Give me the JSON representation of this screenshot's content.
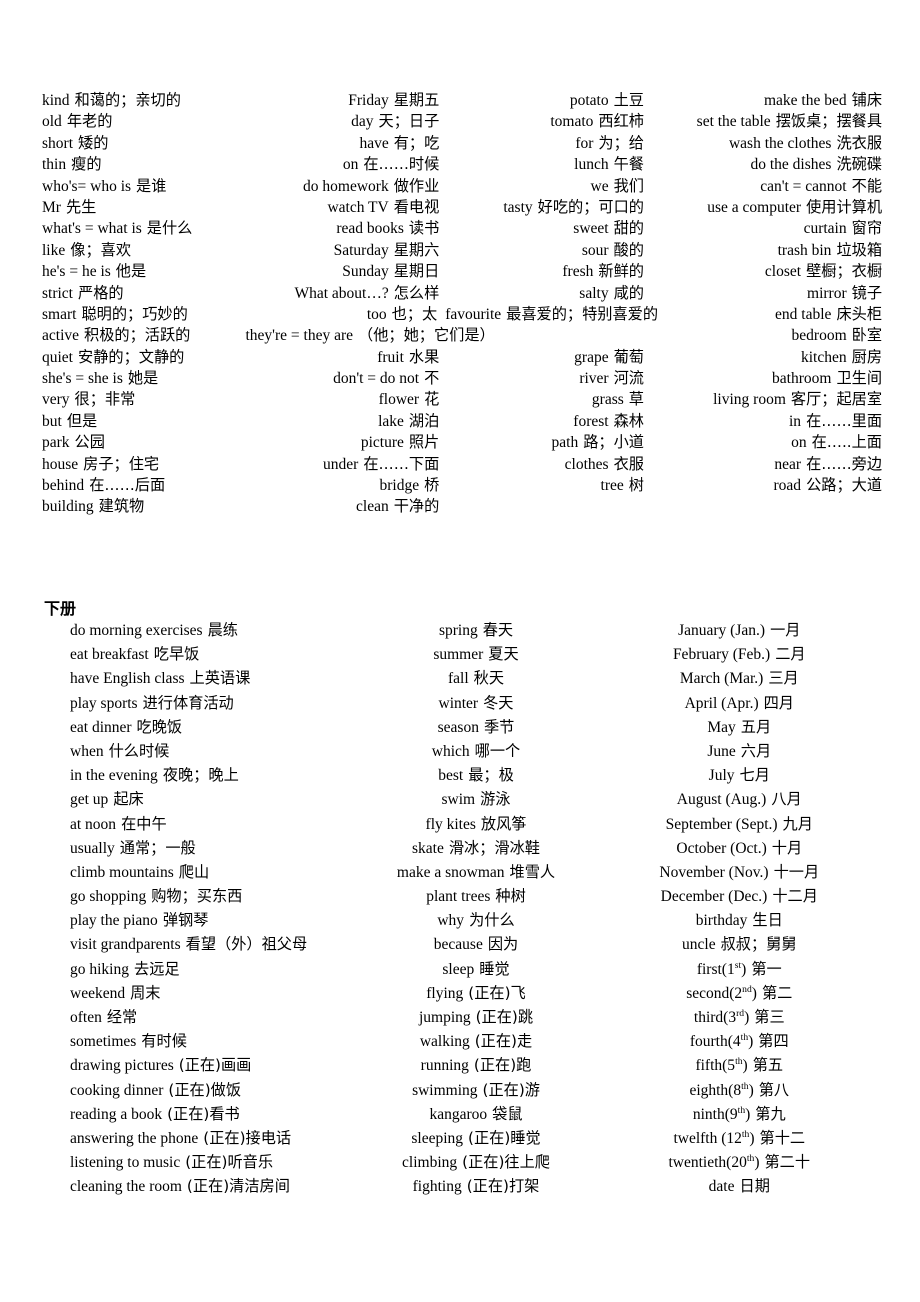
{
  "document": {
    "section1": {
      "rows": [
        [
          {
            "en": "kind",
            "zh": "和蔼的；亲切的"
          },
          {
            "en": "Friday",
            "zh": "星期五"
          },
          {
            "en": "potato",
            "zh": "土豆"
          },
          {
            "en": "make the bed",
            "zh": "铺床"
          }
        ],
        [
          {
            "en": "old",
            "zh": "年老的"
          },
          {
            "en": "day",
            "zh": "天；日子"
          },
          {
            "en": "tomato",
            "zh": "西红柿"
          },
          {
            "en": "set the table",
            "zh": "摆饭桌；摆餐具"
          }
        ],
        [
          {
            "en": "short",
            "zh": "矮的"
          },
          {
            "en": "have",
            "zh": "有；吃"
          },
          {
            "en": "for",
            "zh": "为；给"
          },
          {
            "en": "wash the clothes",
            "zh": "洗衣服"
          }
        ],
        [
          {
            "en": "thin",
            "zh": "瘦的"
          },
          {
            "en": "on",
            "zh": "在……时候"
          },
          {
            "en": "lunch",
            "zh": "午餐"
          },
          {
            "en": "do the dishes",
            "zh": "洗碗碟"
          }
        ],
        [
          {
            "en": "who's= who is",
            "zh": "是谁"
          },
          {
            "en": "do homework",
            "zh": "做作业"
          },
          {
            "en": "we",
            "zh": "我们"
          },
          {
            "en": "can't = cannot",
            "zh": "不能"
          }
        ],
        [
          {
            "en": "Mr",
            "zh": "先生"
          },
          {
            "en": "watch TV",
            "zh": "看电视"
          },
          {
            "en": "tasty",
            "zh": "好吃的；可口的"
          },
          {
            "en": "use a computer",
            "zh": "使用计算机"
          }
        ],
        [
          {
            "en": "what's = what is",
            "zh": "是什么"
          },
          {
            "en": "read books",
            "zh": "读书"
          },
          {
            "en": "sweet",
            "zh": "甜的"
          },
          {
            "en": "curtain",
            "zh": "窗帘"
          }
        ],
        [
          {
            "en": "like",
            "zh": "像；喜欢"
          },
          {
            "en": "Saturday",
            "zh": "星期六"
          },
          {
            "en": "sour",
            "zh": "酸的"
          },
          {
            "en": "trash bin",
            "zh": "垃圾箱"
          }
        ],
        [
          {
            "en": "he's = he is",
            "zh": "他是"
          },
          {
            "en": "Sunday",
            "zh": "星期日"
          },
          {
            "en": "fresh",
            "zh": "新鲜的"
          },
          {
            "en": "closet",
            "zh": "壁橱；衣橱"
          }
        ],
        [
          {
            "en": "strict",
            "zh": "严格的"
          },
          {
            "en": "What about…?",
            "zh": "怎么样"
          },
          {
            "en": "salty",
            "zh": "咸的"
          },
          {
            "en": "mirror",
            "zh": "镜子"
          }
        ],
        [
          {
            "en": "smart",
            "zh": "聪明的；巧妙的"
          },
          {
            "en": "too",
            "zh": "也；太"
          },
          {
            "en": "favourite",
            "zh": "最喜爱的；特别喜爱的"
          },
          {
            "en": "end table",
            "zh": "床头柜"
          }
        ],
        [
          {
            "en": "active",
            "zh": "积极的；活跃的"
          },
          {
            "en": "they're = they are",
            "zh": "（他；她；它们是）"
          },
          {
            "en": "",
            "zh": ""
          },
          {
            "en": "bedroom",
            "zh": "卧室"
          }
        ],
        [
          {
            "en": "quiet",
            "zh": "安静的；文静的"
          },
          {
            "en": "fruit",
            "zh": "水果"
          },
          {
            "en": "grape",
            "zh": "葡萄"
          },
          {
            "en": "kitchen",
            "zh": "厨房"
          }
        ],
        [
          {
            "en": "she's = she is",
            "zh": "她是"
          },
          {
            "en": "don't = do not",
            "zh": "不"
          },
          {
            "en": "river",
            "zh": "河流"
          },
          {
            "en": "bathroom",
            "zh": "卫生间"
          }
        ],
        [
          {
            "en": "very",
            "zh": "很；非常"
          },
          {
            "en": "flower",
            "zh": "花"
          },
          {
            "en": "grass",
            "zh": "草"
          },
          {
            "en": "living room",
            "zh": "客厅；起居室"
          }
        ],
        [
          {
            "en": "but",
            "zh": "但是"
          },
          {
            "en": "lake",
            "zh": "湖泊"
          },
          {
            "en": "forest",
            "zh": "森林"
          },
          {
            "en": "in",
            "zh": "在……里面"
          }
        ],
        [
          {
            "en": "park",
            "zh": "公园"
          },
          {
            "en": "picture",
            "zh": "照片"
          },
          {
            "en": "path",
            "zh": "路；小道"
          },
          {
            "en": "on",
            "zh": "在…..上面"
          }
        ],
        [
          {
            "en": "house",
            "zh": "房子；住宅"
          },
          {
            "en": "under",
            "zh": "在……下面"
          },
          {
            "en": "clothes",
            "zh": "衣服"
          },
          {
            "en": "near",
            "zh": "在……旁边"
          }
        ],
        [
          {
            "en": "behind",
            "zh": "在……后面"
          },
          {
            "en": "bridge",
            "zh": "桥"
          },
          {
            "en": "tree",
            "zh": "树"
          },
          {
            "en": "road",
            "zh": "公路；大道"
          }
        ],
        [
          {
            "en": "building",
            "zh": "建筑物"
          },
          {
            "en": "clean",
            "zh": "干净的"
          },
          {
            "en": "",
            "zh": ""
          },
          {
            "en": "",
            "zh": ""
          }
        ]
      ]
    },
    "section2": {
      "title": "下册",
      "rows": [
        [
          {
            "en": "do morning exercises",
            "zh": "晨练"
          },
          {
            "en": "spring",
            "zh": "春天"
          },
          {
            "en": "January (Jan.)",
            "zh": "一月"
          }
        ],
        [
          {
            "en": "eat breakfast",
            "zh": "吃早饭"
          },
          {
            "en": "summer",
            "zh": "夏天"
          },
          {
            "en": "February (Feb.)",
            "zh": "二月"
          }
        ],
        [
          {
            "en": "have English class",
            "zh": "上英语课"
          },
          {
            "en": "fall",
            "zh": "秋天"
          },
          {
            "en": "March (Mar.)",
            "zh": "三月"
          }
        ],
        [
          {
            "en": "play sports",
            "zh": "进行体育活动"
          },
          {
            "en": "winter",
            "zh": "冬天"
          },
          {
            "en": "April (Apr.)",
            "zh": "四月"
          }
        ],
        [
          {
            "en": "eat dinner",
            "zh": "吃晚饭"
          },
          {
            "en": "season",
            "zh": "季节"
          },
          {
            "en": "May",
            "zh": "五月"
          }
        ],
        [
          {
            "en": "when",
            "zh": "什么时候"
          },
          {
            "en": "which",
            "zh": "哪一个"
          },
          {
            "en": "June",
            "zh": "六月"
          }
        ],
        [
          {
            "en": "in the evening",
            "zh": "夜晚；晚上"
          },
          {
            "en": "best",
            "zh": "最；极"
          },
          {
            "en": "July",
            "zh": "七月"
          }
        ],
        [
          {
            "en": "get up",
            "zh": "起床"
          },
          {
            "en": "swim",
            "zh": "游泳"
          },
          {
            "en": "August (Aug.)",
            "zh": "八月"
          }
        ],
        [
          {
            "en": "at noon",
            "zh": "在中午"
          },
          {
            "en": "fly kites",
            "zh": "放风筝"
          },
          {
            "en": "September (Sept.)",
            "zh": "九月"
          }
        ],
        [
          {
            "en": "usually",
            "zh": "通常；一般"
          },
          {
            "en": "skate",
            "zh": "滑冰；滑冰鞋"
          },
          {
            "en": "October (Oct.)",
            "zh": "十月"
          }
        ],
        [
          {
            "en": "climb mountains",
            "zh": "爬山"
          },
          {
            "en": "make a snowman",
            "zh": "堆雪人"
          },
          {
            "en": "November (Nov.)",
            "zh": "十一月"
          }
        ],
        [
          {
            "en": "go shopping",
            "zh": "购物；买东西"
          },
          {
            "en": "plant trees",
            "zh": "种树"
          },
          {
            "en": "December (Dec.)",
            "zh": "十二月"
          }
        ],
        [
          {
            "en": "play the piano",
            "zh": "弹钢琴"
          },
          {
            "en": "why",
            "zh": "为什么"
          },
          {
            "en": "birthday",
            "zh": "生日"
          }
        ],
        [
          {
            "en": "visit grandparents",
            "zh": "看望（外）祖父母"
          },
          {
            "en": "because",
            "zh": "因为"
          },
          {
            "en": "uncle",
            "zh": "叔叔；舅舅"
          }
        ],
        [
          {
            "en": "go hiking",
            "zh": "去远足"
          },
          {
            "en": "sleep",
            "zh": "睡觉"
          },
          {
            "en": "first(1st)",
            "zh": "第一",
            "sup": "st",
            "base": "first(1",
            "tail": ")"
          }
        ],
        [
          {
            "en": "weekend",
            "zh": "周末"
          },
          {
            "en": "flying",
            "zh": "(正在)飞"
          },
          {
            "en": "second(2nd)",
            "zh": "第二",
            "sup": "nd",
            "base": "second(2",
            "tail": ")"
          }
        ],
        [
          {
            "en": "often",
            "zh": "经常"
          },
          {
            "en": "jumping",
            "zh": "(正在)跳"
          },
          {
            "en": "third(3rd)",
            "zh": "第三",
            "sup": "rd",
            "base": "third(3",
            "tail": ")"
          }
        ],
        [
          {
            "en": "sometimes",
            "zh": "有时候"
          },
          {
            "en": "walking",
            "zh": "(正在)走"
          },
          {
            "en": "fourth(4th)",
            "zh": "第四",
            "sup": "th",
            "base": "fourth(4",
            "tail": ")"
          }
        ],
        [
          {
            "en": "drawing pictures",
            "zh": "(正在)画画"
          },
          {
            "en": "running",
            "zh": "(正在)跑"
          },
          {
            "en": "fifth(5th)",
            "zh": "第五",
            "sup": "th",
            "base": "fifth(5",
            "tail": ")"
          }
        ],
        [
          {
            "en": "cooking dinner",
            "zh": "(正在)做饭"
          },
          {
            "en": "swimming",
            "zh": "(正在)游"
          },
          {
            "en": "eighth(8th)",
            "zh": "第八",
            "sup": "th",
            "base": "eighth(8",
            "tail": ")"
          }
        ],
        [
          {
            "en": "reading a book",
            "zh": "(正在)看书"
          },
          {
            "en": "kangaroo",
            "zh": "袋鼠"
          },
          {
            "en": "ninth(9th)",
            "zh": "第九",
            "sup": "th",
            "base": "ninth(9",
            "tail": ")"
          }
        ],
        [
          {
            "en": "answering the phone",
            "zh": "(正在)接电话"
          },
          {
            "en": "sleeping",
            "zh": "(正在)睡觉"
          },
          {
            "en": "twelfth (12th)",
            "zh": "第十二",
            "sup": "th",
            "base": "twelfth (12",
            "tail": ")"
          }
        ],
        [
          {
            "en": "listening to music",
            "zh": "(正在)听音乐"
          },
          {
            "en": "climbing",
            "zh": "(正在)往上爬"
          },
          {
            "en": "twentieth(20th)",
            "zh": "第二十",
            "sup": "th",
            "base": "twentieth(20",
            "tail": ")"
          }
        ],
        [
          {
            "en": "cleaning the room",
            "zh": "(正在)清洁房间"
          },
          {
            "en": "fighting",
            "zh": "(正在)打架"
          },
          {
            "en": "date",
            "zh": "日期"
          }
        ]
      ]
    }
  }
}
